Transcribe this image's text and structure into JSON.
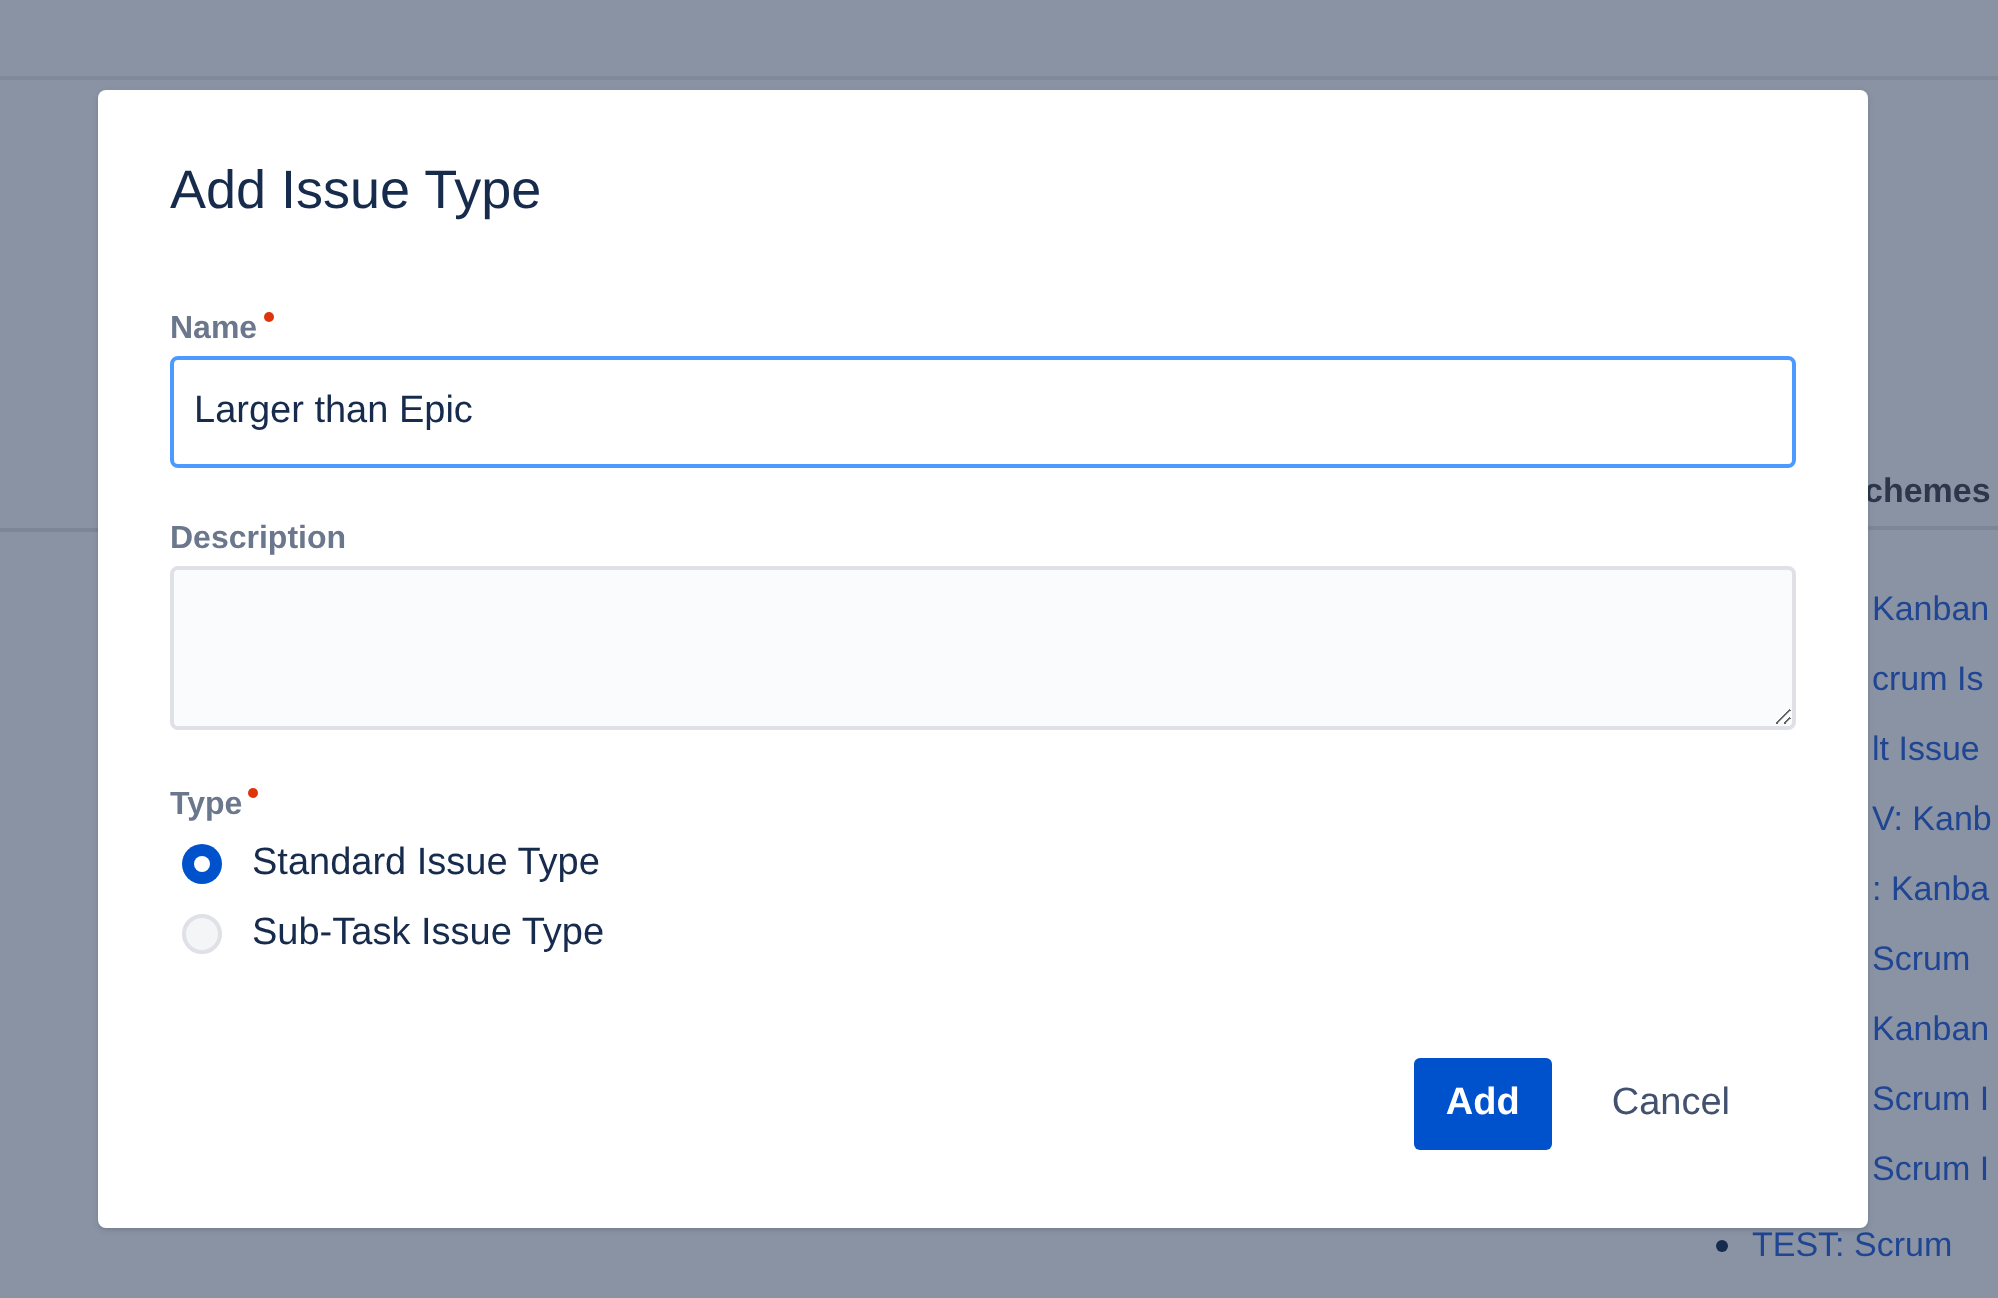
{
  "background_page": {
    "heading": "chemes",
    "items": [
      {
        "text": "Kanban",
        "bullet": false
      },
      {
        "text": "crum Is",
        "bullet": false
      },
      {
        "text": "lt Issue",
        "bullet": false
      },
      {
        "text": "V: Kanb",
        "bullet": false
      },
      {
        "text": ": Kanba",
        "bullet": false
      },
      {
        "text": "Scrum",
        "bullet": false
      },
      {
        "text": "Kanban",
        "bullet": false
      },
      {
        "text": "Scrum I",
        "bullet": false
      },
      {
        "text": "Scrum I",
        "bullet": false
      },
      {
        "text": "TEST: Scrum",
        "bullet": true
      }
    ]
  },
  "dialog": {
    "title": "Add Issue Type",
    "fields": [
      {
        "kind": "text",
        "label": "Name",
        "required": true,
        "value": "Larger than Epic",
        "focused": true
      },
      {
        "kind": "textarea",
        "label": "Description",
        "required": false,
        "focused": false
      },
      {
        "kind": "radio",
        "label": "Type",
        "required": true,
        "options": [
          {
            "label": "Standard Issue Type",
            "selected": true
          },
          {
            "label": "Sub-Task Issue Type",
            "selected": false
          }
        ]
      }
    ],
    "buttons": [
      {
        "label": "Add",
        "kind": "primary"
      },
      {
        "label": "Cancel",
        "kind": "subtle"
      }
    ]
  }
}
